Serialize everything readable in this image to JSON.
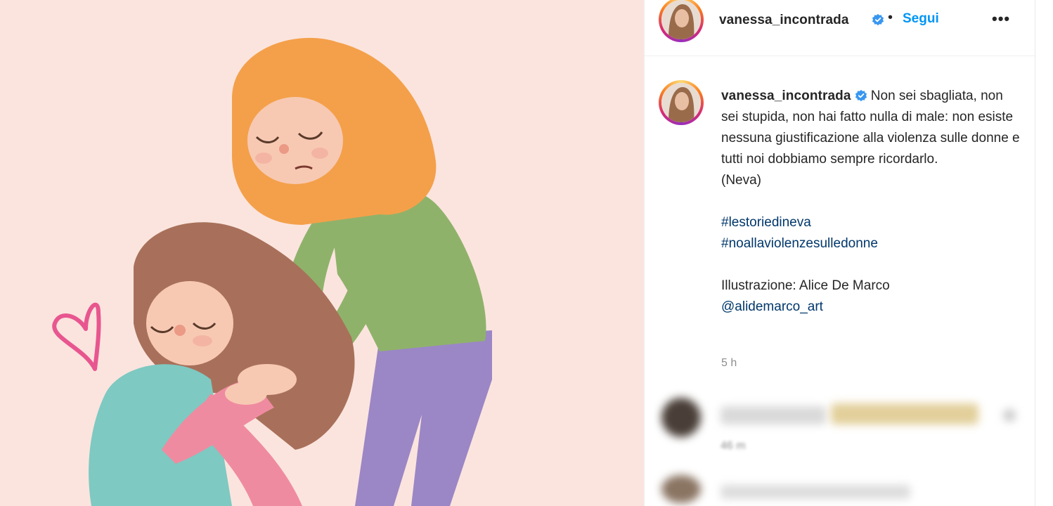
{
  "header": {
    "username": "vanessa_incontrada",
    "dot": "•",
    "follow_label": "Segui",
    "more_label": "•••"
  },
  "caption": {
    "username": "vanessa_incontrada",
    "text_lines": [
      "Non sei sbagliata, non sei stupida, non hai fatto nulla di male: non esiste nessuna giustificazione alla violenza sulle donne e tutti noi dobbiamo sempre ricordarlo.",
      "(Neva)"
    ],
    "hashtags": [
      "#lestoriedineva",
      "#noallaviolenzesulledonne"
    ],
    "credit_label": "Illustrazione: Alice De Marco",
    "credit_handle": "@alidemarco_art",
    "time": "5 h"
  },
  "comments": [
    {
      "time": "46 m"
    }
  ],
  "colors": {
    "accent": "#0095f6",
    "hashtag": "#00376b",
    "verified": "#3897f0",
    "image_bg": "#fbe4de"
  },
  "icons": {
    "verified": "verified-badge-icon",
    "more": "more-options-icon"
  }
}
